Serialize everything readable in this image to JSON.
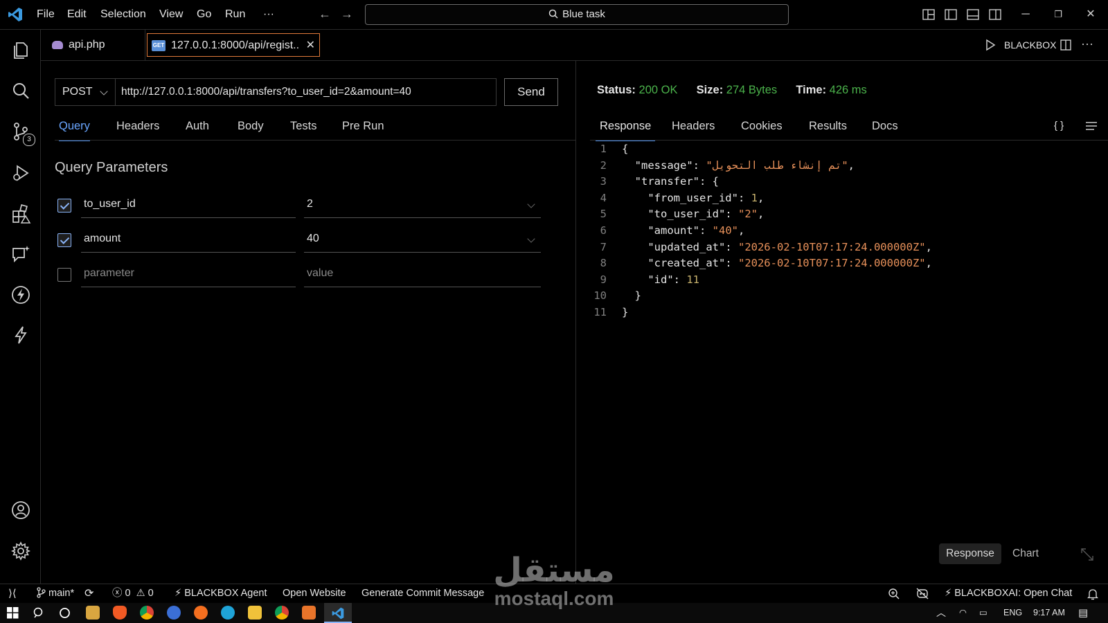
{
  "titlebar": {
    "menu": [
      "File",
      "Edit",
      "Selection",
      "View",
      "Go",
      "Run",
      "···"
    ],
    "search_text": "Blue task"
  },
  "activity_bar": {
    "source_control_badge": "3"
  },
  "tabs": [
    {
      "label": "api.php"
    },
    {
      "label": "127.0.0.1:8000/api/regist..",
      "method_badge": "GET"
    }
  ],
  "tabs_right": {
    "label": "BLACKBOX"
  },
  "request": {
    "method": "POST",
    "url": "http://127.0.0.1:8000/api/transfers?to_user_id=2&amount=40",
    "send_label": "Send",
    "subtabs": [
      "Query",
      "Headers",
      "Auth",
      "Body",
      "Tests",
      "Pre Run"
    ],
    "active_subtab": "Query",
    "params_title": "Query Parameters",
    "params": [
      {
        "checked": true,
        "key": "to_user_id",
        "value": "2"
      },
      {
        "checked": true,
        "key": "amount",
        "value": "40"
      }
    ],
    "new_param_placeholder_key": "parameter",
    "new_param_placeholder_value": "value"
  },
  "response": {
    "status_label": "Status:",
    "status_value": "200 OK",
    "size_label": "Size:",
    "size_value": "274 Bytes",
    "time_label": "Time:",
    "time_value": "426 ms",
    "subtabs": [
      "Response",
      "Headers",
      "Cookies",
      "Results",
      "Docs"
    ],
    "active_subtab": "Response",
    "json_icon": "{ }",
    "body_lines": [
      {
        "n": "1",
        "indent": "",
        "key": "",
        "val": "{",
        "type": "pun",
        "trail": ""
      },
      {
        "n": "2",
        "indent": "  ",
        "key": "\"message\"",
        "val": "\"تم إنشاء طلب التحويل\"",
        "type": "str",
        "trail": ","
      },
      {
        "n": "3",
        "indent": "  ",
        "key": "\"transfer\"",
        "val": "{",
        "type": "pun",
        "trail": ""
      },
      {
        "n": "4",
        "indent": "    ",
        "key": "\"from_user_id\"",
        "val": "1",
        "type": "num",
        "trail": ","
      },
      {
        "n": "5",
        "indent": "    ",
        "key": "\"to_user_id\"",
        "val": "\"2\"",
        "type": "str",
        "trail": ","
      },
      {
        "n": "6",
        "indent": "    ",
        "key": "\"amount\"",
        "val": "\"40\"",
        "type": "str",
        "trail": ","
      },
      {
        "n": "7",
        "indent": "    ",
        "key": "\"updated_at\"",
        "val": "\"2026-02-10T07:17:24.000000Z\"",
        "type": "str",
        "trail": ","
      },
      {
        "n": "8",
        "indent": "    ",
        "key": "\"created_at\"",
        "val": "\"2026-02-10T07:17:24.000000Z\"",
        "type": "str",
        "trail": ","
      },
      {
        "n": "9",
        "indent": "    ",
        "key": "\"id\"",
        "val": "11",
        "type": "num",
        "trail": ""
      },
      {
        "n": "10",
        "indent": "  ",
        "key": "",
        "val": "}",
        "type": "pun",
        "trail": ""
      },
      {
        "n": "11",
        "indent": "",
        "key": "",
        "val": "}",
        "type": "pun",
        "trail": ""
      }
    ],
    "bottom_buttons": [
      "Response",
      "Chart"
    ]
  },
  "statusbar": {
    "branch": "main*",
    "errors": "0",
    "warnings": "0",
    "agent": "BLACKBOX Agent",
    "open_website": "Open Website",
    "commit_msg": "Generate Commit Message",
    "chat": "BLACKBOXAI: Open Chat"
  },
  "taskbar": {
    "lang": "ENG",
    "time": "9:17 AM"
  },
  "watermark": {
    "arabic": "مستقل",
    "latin": "mostaql.com"
  },
  "colors": {
    "accent": "#4e8ee8",
    "status_green": "#4bb34b",
    "string_orange": "#e8915a",
    "tab_border": "#e07a3a"
  }
}
